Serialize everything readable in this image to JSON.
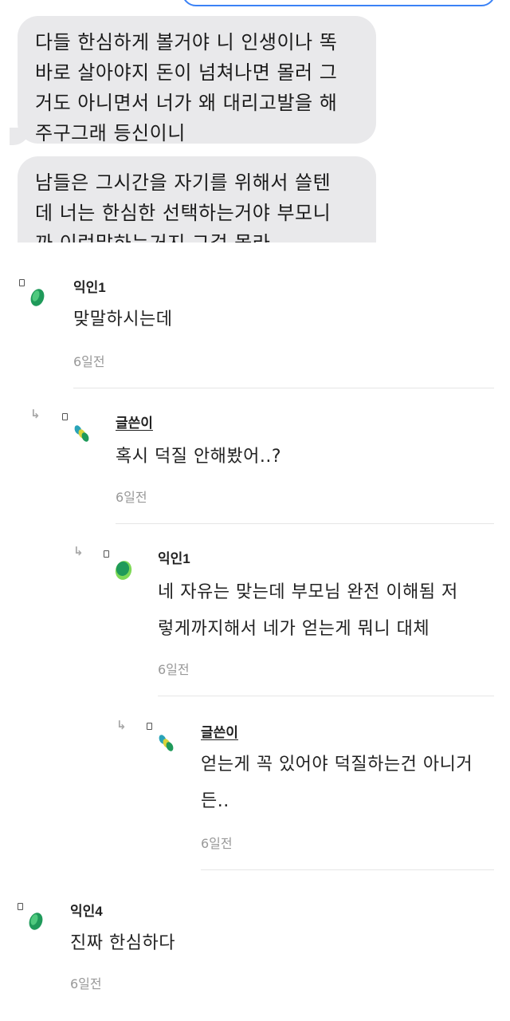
{
  "chat": {
    "messages": [
      {
        "lines": [
          "다들 한심하게 볼거야 니 인생이나 똑",
          "바로 살아야지 돈이 넘쳐나면 몰러 그",
          "거도 아니면서 너가 왜 대리고발을 해",
          "주구그래 등신이니"
        ]
      },
      {
        "lines": [
          "남들은 그시간을 자기를 위해서 쓸텐",
          "데 너는 한심한 선택하는거야 부모니",
          "까 이런말하는거지     그걸 몰라"
        ]
      }
    ]
  },
  "comments": [
    {
      "author": "익인1",
      "is_op": false,
      "is_reply": false,
      "lines": [
        "맞말하시는데"
      ],
      "time": "6일전",
      "avatar": "green-oval"
    },
    {
      "author": "글쓴이",
      "is_op": true,
      "is_reply": true,
      "lines": [
        "혹시 덕질 안해봤어..?"
      ],
      "time": "6일전",
      "avatar": "multi-color-leaves"
    },
    {
      "author": "익인1",
      "is_op": false,
      "is_reply": true,
      "lines": [
        "네 자유는 맞는데 부모님 완전 이해됨 저",
        "렇게까지해서 네가 얻는게 뭐니 대체"
      ],
      "time": "6일전",
      "avatar": "green-oval"
    },
    {
      "author": "글쓴이",
      "is_op": true,
      "is_reply": true,
      "lines": [
        "얻는게 꼭 있어야 덕질하는건 아니거",
        "든.."
      ],
      "time": "6일전",
      "avatar": "multi-color-leaves"
    },
    {
      "author": "익인4",
      "is_op": false,
      "is_reply": false,
      "lines": [
        "진짜 한심하다"
      ],
      "time": "6일전",
      "avatar": "green-oval"
    }
  ],
  "icons": {
    "reply": "reply-arrow-icon",
    "marker": "comment-marker-icon"
  },
  "colors": {
    "bubble": "#e9e9eb",
    "sent_bubble_border": "#3b82f6",
    "avatar_green_dark": "#1f9a5a",
    "avatar_green_light": "#4fc97e",
    "avatar_teal": "#2aa3b8",
    "avatar_yellow": "#d9d33a",
    "timestamp": "#999999"
  }
}
